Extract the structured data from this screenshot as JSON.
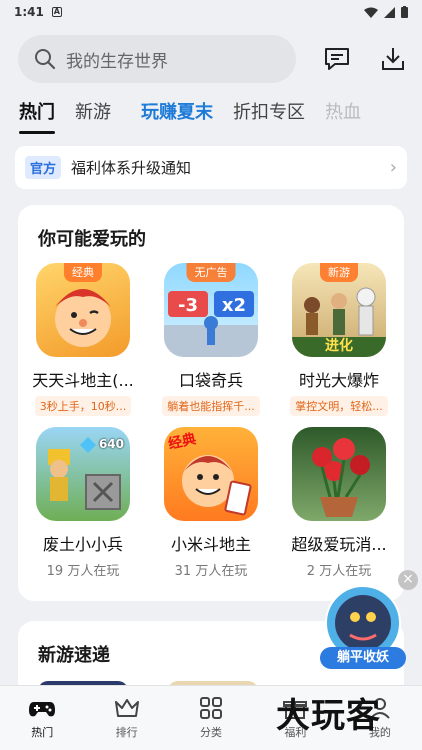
{
  "status_bar": {
    "time": "1:41",
    "app_badge": "A"
  },
  "search": {
    "placeholder": "我的生存世界"
  },
  "tabs": [
    "热门",
    "新游",
    "玩赚夏末",
    "折扣专区",
    "热血"
  ],
  "notice": {
    "tag": "官方",
    "text": "福利体系升级通知"
  },
  "recommend": {
    "title": "你可能爱玩的",
    "games": [
      {
        "name": "天天斗地主(...",
        "badge": "经典",
        "tip": "3秒上手，10秒...",
        "icon": "doudizhu-man-icon"
      },
      {
        "name": "口袋奇兵",
        "badge": "无广告",
        "tip": "躺着也能指挥千...",
        "icon": "number-runner-icon"
      },
      {
        "name": "时光大爆炸",
        "badge": "新游",
        "tip": "掌控文明，轻松...",
        "icon": "evolution-icon"
      },
      {
        "name": "废土小小兵",
        "sub": "19 万人在玩",
        "icon": "miner-icon"
      },
      {
        "name": "小米斗地主",
        "sub": "31 万人在玩",
        "icon": "card-player-icon",
        "badge_text": "经典"
      },
      {
        "name": "超级爱玩消...",
        "sub": "2 万人在玩",
        "icon": "roses-icon"
      }
    ],
    "counter": "640"
  },
  "evolution_label": "进化",
  "new_games": {
    "title": "新游速递"
  },
  "float_ad": {
    "label": "躺平收妖"
  },
  "bottom_nav": [
    "热门",
    "排行",
    "分类",
    "福利",
    "我的"
  ],
  "watermark": "大玩客",
  "colors": {
    "accent": "#1e7bd8",
    "tip_bg": "#fff1e6",
    "tip_text": "#e0651a"
  }
}
